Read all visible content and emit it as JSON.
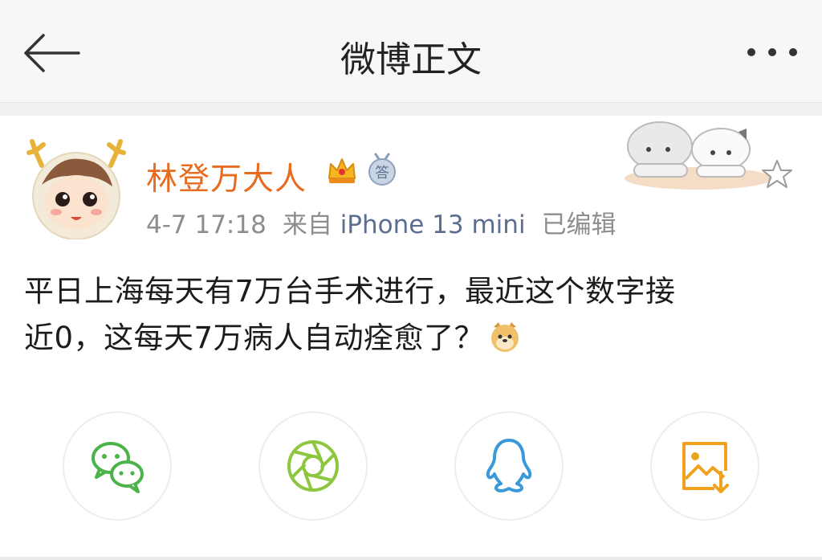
{
  "nav": {
    "title": "微博正文",
    "back_icon": "back-arrow-icon",
    "more_icon": "more-dots-icon"
  },
  "post": {
    "author": "林登万大人",
    "badges": [
      "crown-icon",
      "answer-badge-icon"
    ],
    "badge_answer_char": "答",
    "date": "4-7 17:18",
    "from_label": "来自",
    "source": "iPhone 13 mini",
    "edited": "已编辑",
    "content_lines": [
      "平日上海每天有7万台手术进行，最近这个数字接",
      "近0，这每天7万病人自动痊愈了？"
    ],
    "emoji": "doge-emoji-icon"
  },
  "share": [
    {
      "name": "wechat",
      "icon": "wechat-icon",
      "color": "#4cb24a"
    },
    {
      "name": "moments",
      "icon": "moments-aperture-icon",
      "color": "#8dc63f"
    },
    {
      "name": "qq",
      "icon": "qq-penguin-icon",
      "color": "#3a9ad9"
    },
    {
      "name": "save-image",
      "icon": "save-image-icon",
      "color": "#f0a21f"
    }
  ],
  "colors": {
    "username": "#e86b1f",
    "source": "#5b6e8f",
    "meta": "#8d8d8d",
    "text": "#1c1c1c"
  }
}
